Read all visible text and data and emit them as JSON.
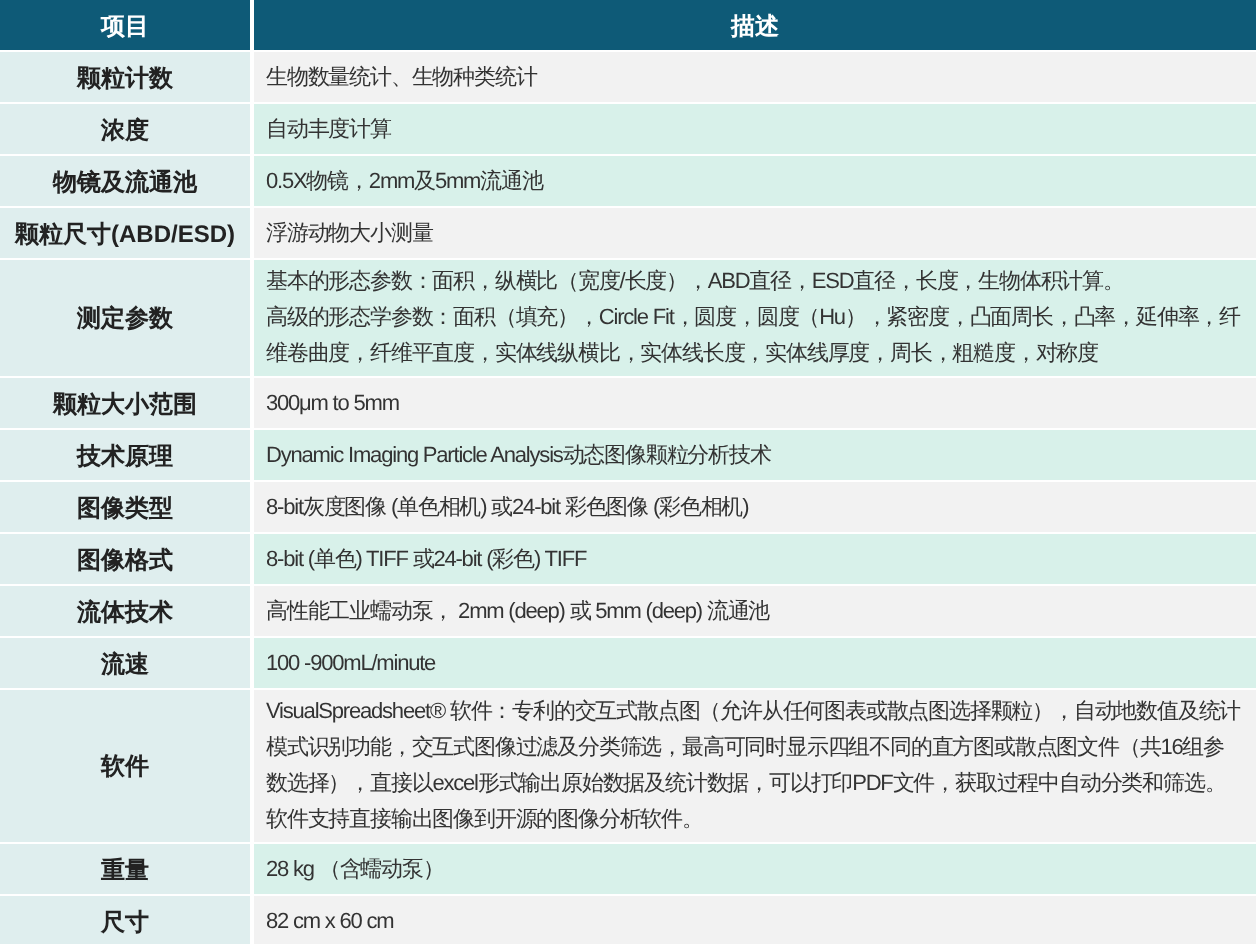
{
  "table": {
    "columns": [
      "项目",
      "描述"
    ],
    "rows": [
      {
        "item": "颗粒计数",
        "description": [
          "生物数量统计、生物种类统计"
        ],
        "shaded": false
      },
      {
        "item": "浓度",
        "description": [
          "自动丰度计算"
        ],
        "shaded": true
      },
      {
        "item": "物镜及流通池",
        "description": [
          "0.5X物镜，2mm及5mm流通池"
        ],
        "shaded": true
      },
      {
        "item": "颗粒尺寸(ABD/ESD)",
        "description": [
          "浮游动物大小测量"
        ],
        "shaded": false
      },
      {
        "item": "测定参数",
        "description": [
          "基本的形态参数：面积，纵横比（宽度/长度），ABD直径，ESD直径，长度，生物体积计算。",
          "高级的形态学参数：面积（填充），Circle Fit，圆度，圆度（Hu），紧密度，凸面周长，凸率，延伸率，纤维卷曲度，纤维平直度，实体线纵横比，实体线长度，实体线厚度，周长，粗糙度，对称度"
        ],
        "shaded": true
      },
      {
        "item": "颗粒大小范围",
        "description": [
          "300μm to 5mm"
        ],
        "shaded": false
      },
      {
        "item": "技术原理",
        "description": [
          "Dynamic Imaging Particle Analysis动态图像颗粒分析技术"
        ],
        "shaded": true
      },
      {
        "item": "图像类型",
        "description": [
          "8-bit灰度图像 (单色相机) 或24-bit 彩色图像 (彩色相机)"
        ],
        "shaded": false
      },
      {
        "item": "图像格式",
        "description": [
          "8-bit (单色) TIFF 或24-bit (彩色) TIFF"
        ],
        "shaded": true
      },
      {
        "item": "流体技术",
        "description": [
          "高性能工业蠕动泵， 2mm (deep) 或 5mm (deep) 流通池"
        ],
        "shaded": false
      },
      {
        "item": "流速",
        "description": [
          "100 -900mL/minute"
        ],
        "shaded": true
      },
      {
        "item": "软件",
        "description": [
          "VisualSpreadsheet® 软件：专利的交互式散点图（允许从任何图表或散点图选择颗粒），自动地数值及统计模式识别功能，交互式图像过滤及分类筛选，最高可同时显示四组不同的直方图或散点图文件（共16组参数选择），直接以excel形式输出原始数据及统计数据，可以打印PDF文件，获取过程中自动分类和筛选。软件支持直接输出图像到开源的图像分析软件。"
        ],
        "shaded": false
      },
      {
        "item": "重量",
        "description": [
          "28 kg （含蠕动泵）"
        ],
        "shaded": true
      },
      {
        "item": "尺寸",
        "description": [
          "82 cm x 60 cm"
        ],
        "shaded": false
      }
    ]
  }
}
